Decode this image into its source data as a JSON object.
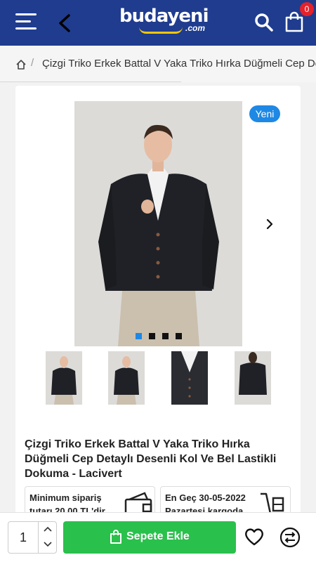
{
  "header": {
    "logo_text": "budayeni",
    "logo_sub": ".com",
    "cart_count": "0",
    "colors": {
      "bar": "#1f3c8f",
      "badge": "#e5212a",
      "logo_accent": "#f7c600"
    }
  },
  "breadcrumb": {
    "separator": "/",
    "current": "Çizgi Triko Erkek Battal V Yaka Triko Hırka Düğmeli Cep Detaylı Desenli Kol Ve Bel Lastikli Dokuma - Lacivert"
  },
  "gallery": {
    "badge_label": "Yeni",
    "slide_count": 4,
    "active_slide": 1,
    "thumbnail_count": 4
  },
  "product": {
    "title": "Çizgi Triko Erkek Battal V Yaka Triko Hırka Düğmeli Cep Detaylı Desenli Kol Ve Bel Lastikli Dokuma - Lacivert"
  },
  "info": {
    "min_order_line1": "Minimum sipariş",
    "min_order_line2": "tutarı 20,00 TL'dir",
    "delivery_line1": "En Geç 30-05-2022",
    "delivery_line2": "Pazartesi kargoda"
  },
  "bottom": {
    "quantity": "1",
    "add_to_cart_label": "Sepete Ekle",
    "colors": {
      "add_button": "#2ac04c"
    }
  }
}
